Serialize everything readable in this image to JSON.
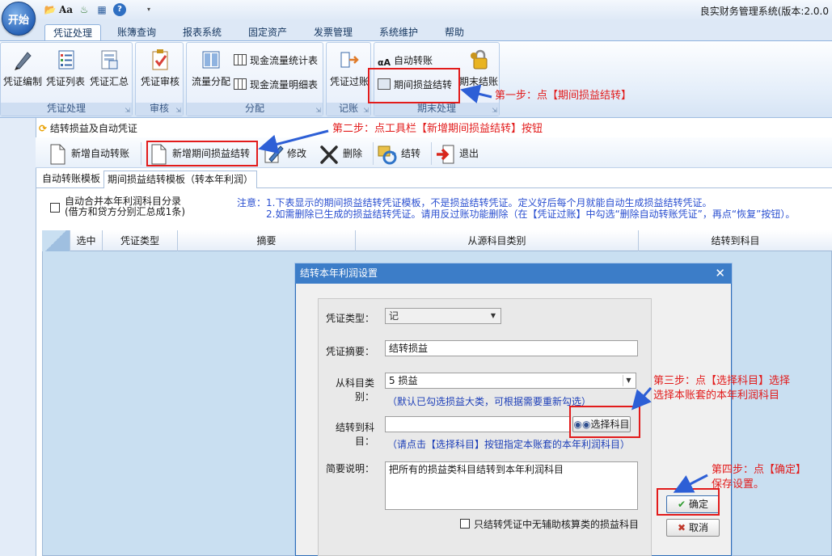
{
  "app": {
    "orb_label": "开始",
    "window_title": "良实财务管理系统(版本:2.0.0"
  },
  "quick_access": [
    "folder-open-icon",
    "font-icon",
    "palette-icon",
    "table-icon",
    "help-icon",
    "dropdown-icon"
  ],
  "ribbon": {
    "tabs": [
      {
        "label": "凭证处理",
        "active": true
      },
      {
        "label": "账簿查询"
      },
      {
        "label": "报表系统"
      },
      {
        "label": "固定资产"
      },
      {
        "label": "发票管理"
      },
      {
        "label": "系统维护"
      },
      {
        "label": "帮助"
      }
    ],
    "groups": {
      "voucher": {
        "label": "凭证处理",
        "buttons": [
          "凭证编制",
          "凭证列表",
          "凭证汇总"
        ]
      },
      "audit": {
        "label": "审核",
        "buttons": [
          "凭证审核"
        ]
      },
      "allocation": {
        "label": "分配",
        "big": "流量分配",
        "small": [
          "现金流量统计表",
          "现金流量明细表"
        ]
      },
      "posting": {
        "label": "记账",
        "buttons": [
          "凭证过账"
        ]
      },
      "closing": {
        "label": "期末处理",
        "small": [
          "自动转账",
          "期间损益结转"
        ],
        "big": "期末结账"
      }
    }
  },
  "document": {
    "title": "结转损益及自动凭证",
    "toolbar": [
      "新增自动转账",
      "新增期间损益结转",
      "修改",
      "删除",
      "结转",
      "退出"
    ],
    "subtabs": [
      {
        "label": "自动转账模板"
      },
      {
        "label": "期间损益结转模板（转本年利润）",
        "active": true
      }
    ],
    "merge_checkbox": {
      "line1": "自动合并本年利润科目分录",
      "line2": "(借方和贷方分别汇总成1条)",
      "checked": false
    },
    "note": {
      "prefix": "注意：",
      "line1": "1.下表显示的期间损益结转凭证模板，不是损益结转凭证。定义好后每个月就能自动生成损益结转凭证。",
      "line2": "2.如需删除已生成的损益结转凭证。请用反过账功能删除（在【凭证过账】中勾选“删除自动转账凭证”，再点“恢复”按钮）。"
    },
    "grid_columns": [
      "选中",
      "凭证类型",
      "摘要",
      "从源科目类别",
      "结转到科目"
    ]
  },
  "dialog": {
    "title": "结转本年利润设置",
    "voucher_type_label": "凭证类型：",
    "voucher_type_value": "记",
    "summary_label": "凭证摘要：",
    "summary_value": "结转损益",
    "from_category_label": "从科目类别：",
    "from_category_value": "5 损益",
    "from_category_hint": "（默认已勾选损益大类，可根据需要重新勾选）",
    "target_account_label": "结转到科目：",
    "target_account_value": "",
    "select_account_button": "选择科目",
    "target_account_hint": "（请点击【选择科目】按钮指定本账套的本年利润科目）",
    "description_label": "简要说明：",
    "description_value": "把所有的损益类科目结转到本年利润科目",
    "only_checkbox_label": "只结转凭证中无辅助核算类的损益科目",
    "only_checkbox_checked": false,
    "ok_button": "确定",
    "cancel_button": "取消"
  },
  "annotations": {
    "step1": "第一步：点【期间损益结转】",
    "step2": "第二步：点工具栏【新增期间损益结转】按钮",
    "step3_line1": "第三步：点【选择科目】选择",
    "step3_line2": "选择本账套的本年利润科目",
    "step4_line1": "第四步：点【确定】",
    "step4_line2": "保存设置。"
  },
  "colors": {
    "annotation_red": "#e21b1b",
    "annotation_arrow_blue": "#2d5fd6",
    "dialog_title_bg": "#3c7dc8",
    "grid_bg": "#c9dff1",
    "note_blue": "#2a4fd0"
  }
}
